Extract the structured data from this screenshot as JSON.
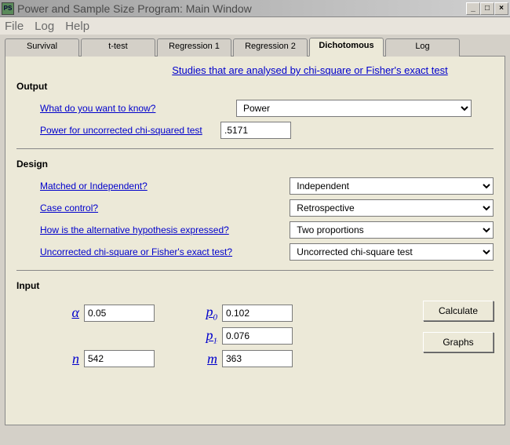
{
  "window": {
    "title": "Power and Sample Size Program:  Main Window",
    "icon_text": "PS"
  },
  "menu": {
    "file": "File",
    "log": "Log",
    "help": "Help"
  },
  "tabs": {
    "survival": "Survival",
    "ttest": "t-test",
    "reg1": "Regression 1",
    "reg2": "Regression 2",
    "dich": "Dichotomous",
    "log": "Log"
  },
  "panel": {
    "toplink": "Studies that are analysed by chi-square or Fisher's exact test",
    "output_head": "Output",
    "q_want": "What do you want to know?",
    "want_value": "Power",
    "q_power": "Power for uncorrected chi-squared test",
    "power_value": ".5171",
    "design_head": "Design",
    "q_matched": "Matched or Independent?",
    "matched_value": "Independent",
    "q_case": "Case control?",
    "case_value": "Retrospective",
    "q_alt": "How is the alternative hypothesis expressed?",
    "alt_value": "Two proportions",
    "q_test": "Uncorrected chi-square or Fisher's exact test?",
    "test_value": "Uncorrected chi-square test",
    "input_head": "Input",
    "alpha_lbl": "α",
    "alpha_val": "0.05",
    "p0_lbl": "p",
    "p0_sub": "0",
    "p0_val": "0.102",
    "p1_lbl": "p",
    "p1_sub": "1",
    "p1_val": "0.076",
    "n_lbl": "n",
    "n_val": "542",
    "m_lbl": "m",
    "m_val": "363",
    "calc_btn": "Calculate",
    "graphs_btn": "Graphs"
  }
}
